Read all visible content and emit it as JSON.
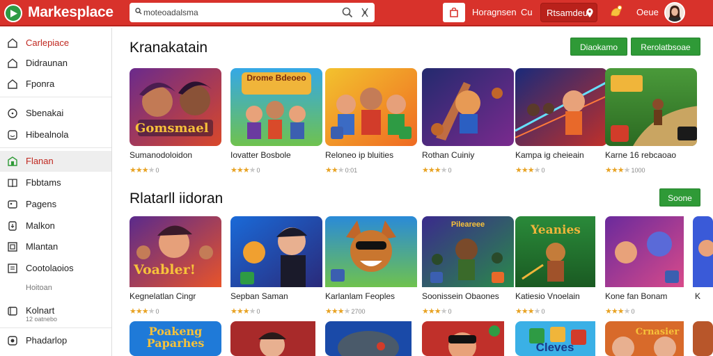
{
  "app": {
    "title": "Markesplace",
    "search_value": "moteoadalsma",
    "top_links": [
      "Horagnsen",
      "Cu"
    ],
    "account_label": "Rtsamdeu",
    "user_label": "Oeue"
  },
  "sidebar": {
    "items": [
      {
        "label": "Carlepiace",
        "icon": "storefront-icon",
        "active": false
      },
      {
        "label": "Didraunan",
        "icon": "home-icon",
        "active": false
      },
      {
        "label": "Fponra",
        "icon": "home-icon",
        "active": false
      },
      {
        "label": "Sbenakai",
        "icon": "clock-icon",
        "active": false
      },
      {
        "label": "Hibealnola",
        "icon": "smile-icon",
        "active": false
      },
      {
        "label": "Flanan",
        "icon": "apps-icon",
        "active": true
      },
      {
        "label": "Fbbtams",
        "icon": "book-icon",
        "active": false
      },
      {
        "label": "Pagens",
        "icon": "gallery-icon",
        "active": false
      },
      {
        "label": "Malkon",
        "icon": "download-icon",
        "active": false
      },
      {
        "label": "Mlantan",
        "icon": "grid-icon",
        "active": false
      },
      {
        "label": "Cootolaoios",
        "icon": "list-icon",
        "active": false
      },
      {
        "label": "Kolnart",
        "icon": "kit-icon",
        "active": false
      },
      {
        "label": "Phadarlop",
        "icon": "record-icon",
        "active": false
      }
    ],
    "sub_label": "Hoitoan",
    "sub_caption": "12 oatnebo"
  },
  "sections": [
    {
      "title": "Kranakatain",
      "buttons": [
        "Diaokamo",
        "Rerolatbsoae"
      ],
      "cards": [
        {
          "title": "Sumanodoloidon",
          "rating": 3,
          "count": "0",
          "image_text": "Gomsmael"
        },
        {
          "title": "Iovatter Bosbole",
          "rating": 3,
          "count": "0",
          "image_text": "Drome Bdeoeo"
        },
        {
          "title": "Reloneo ip bluities",
          "rating": 2,
          "count": "0:01",
          "image_text": ""
        },
        {
          "title": "Rothan Cuiniy",
          "rating": 3,
          "count": "0",
          "image_text": ""
        },
        {
          "title": "Kampa ig cheieain",
          "rating": 3,
          "count": "0",
          "image_text": ""
        },
        {
          "title": "Karne 16 rebcaoao",
          "rating": 3,
          "count": "1000",
          "image_text": ""
        }
      ]
    },
    {
      "title": "Rlatarll iidoran",
      "buttons": [
        "Soone"
      ],
      "cards": [
        {
          "title": "Kegnelatlan Cingr",
          "rating": 3,
          "count": "0",
          "image_text": "Voabler!"
        },
        {
          "title": "Sepban Saman",
          "rating": 3,
          "count": "0",
          "image_text": ""
        },
        {
          "title": "Karlanlam Feoples",
          "rating": 3,
          "count": "2700",
          "image_text": ""
        },
        {
          "title": "Soonissein Obaones",
          "rating": 3,
          "count": "0",
          "image_text": "Pileareee"
        },
        {
          "title": "Katiesio Vnoelain",
          "rating": 3,
          "count": "0",
          "image_text": "Yeanies"
        },
        {
          "title": "Kone fan Bonam",
          "rating": 3,
          "count": "0",
          "image_text": ""
        }
      ]
    },
    {
      "title": "",
      "buttons": [],
      "cards": [
        {
          "title": "",
          "rating": 0,
          "count": "",
          "image_text": "Poakeng Paparhes"
        },
        {
          "title": "",
          "rating": 0,
          "count": "",
          "image_text": ""
        },
        {
          "title": "",
          "rating": 0,
          "count": "",
          "image_text": ""
        },
        {
          "title": "",
          "rating": 0,
          "count": "",
          "image_text": ""
        },
        {
          "title": "",
          "rating": 0,
          "count": "",
          "image_text": "Cleves"
        },
        {
          "title": "",
          "rating": 0,
          "count": "",
          "image_text": "Crnasier"
        }
      ]
    }
  ],
  "colors": {
    "brand_red": "#d8322b",
    "action_green": "#2f9a37",
    "active_text": "#c0271f",
    "star": "#e8a324"
  }
}
